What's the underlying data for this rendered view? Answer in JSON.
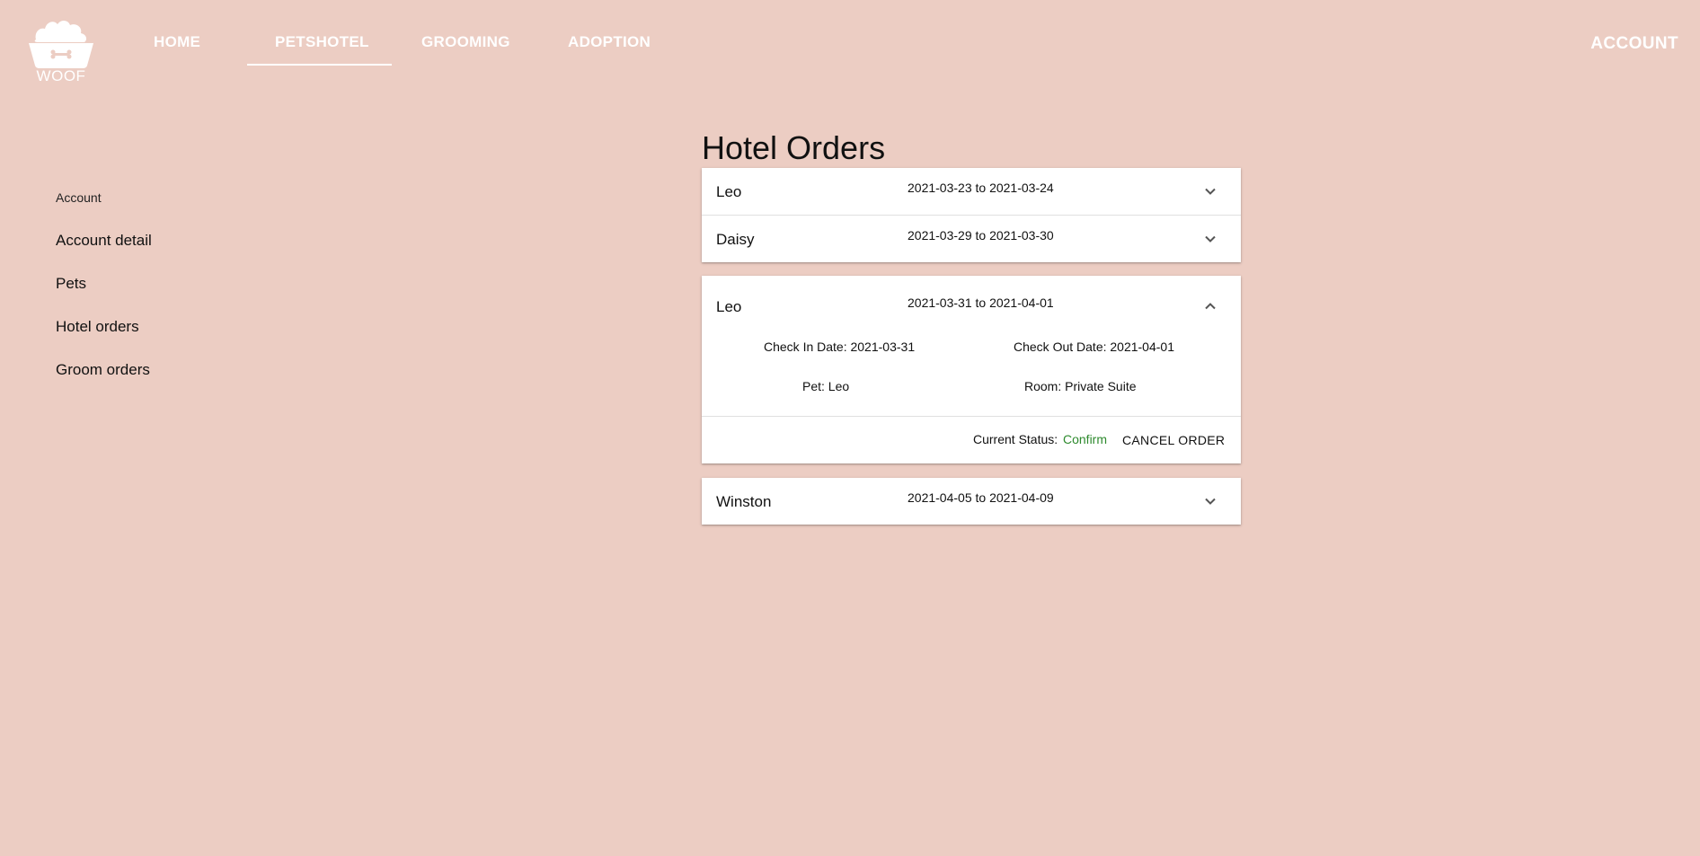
{
  "brand": {
    "logo_text": "WOOF"
  },
  "nav": {
    "items": [
      {
        "label": "HOME"
      },
      {
        "label": "PETSHOTEL"
      },
      {
        "label": "GROOMING"
      },
      {
        "label": "ADOPTION"
      }
    ],
    "active": "PETSHOTEL",
    "account_label": "ACCOUNT"
  },
  "sidebar": {
    "heading": "Account",
    "items": [
      {
        "label": "Account detail"
      },
      {
        "label": "Pets"
      },
      {
        "label": "Hotel orders"
      },
      {
        "label": "Groom orders"
      }
    ]
  },
  "main": {
    "title": "Hotel Orders",
    "orders": [
      {
        "pet": "Leo",
        "dates": "2021-03-23 to 2021-03-24",
        "expanded": false
      },
      {
        "pet": "Daisy",
        "dates": "2021-03-29 to 2021-03-30",
        "expanded": false
      },
      {
        "pet": "Leo",
        "dates": "2021-03-31 to 2021-04-01",
        "expanded": true,
        "check_in": "Check In Date: 2021-03-31",
        "check_out": "Check Out Date: 2021-04-01",
        "pet_label": "Pet: Leo",
        "room": "Room: Private Suite",
        "status_label": "Current Status:",
        "status_value": "Confirm",
        "cancel_label": "CANCEL ORDER"
      },
      {
        "pet": "Winston",
        "dates": "2021-04-05 to 2021-04-09",
        "expanded": false
      }
    ]
  },
  "colors": {
    "background": "#eccdc3",
    "status_confirm": "#2e8a2e"
  },
  "icons": {
    "logo": "dog-bowl-icon",
    "collapsed": "chevron-down-icon",
    "expanded": "chevron-up-icon"
  }
}
